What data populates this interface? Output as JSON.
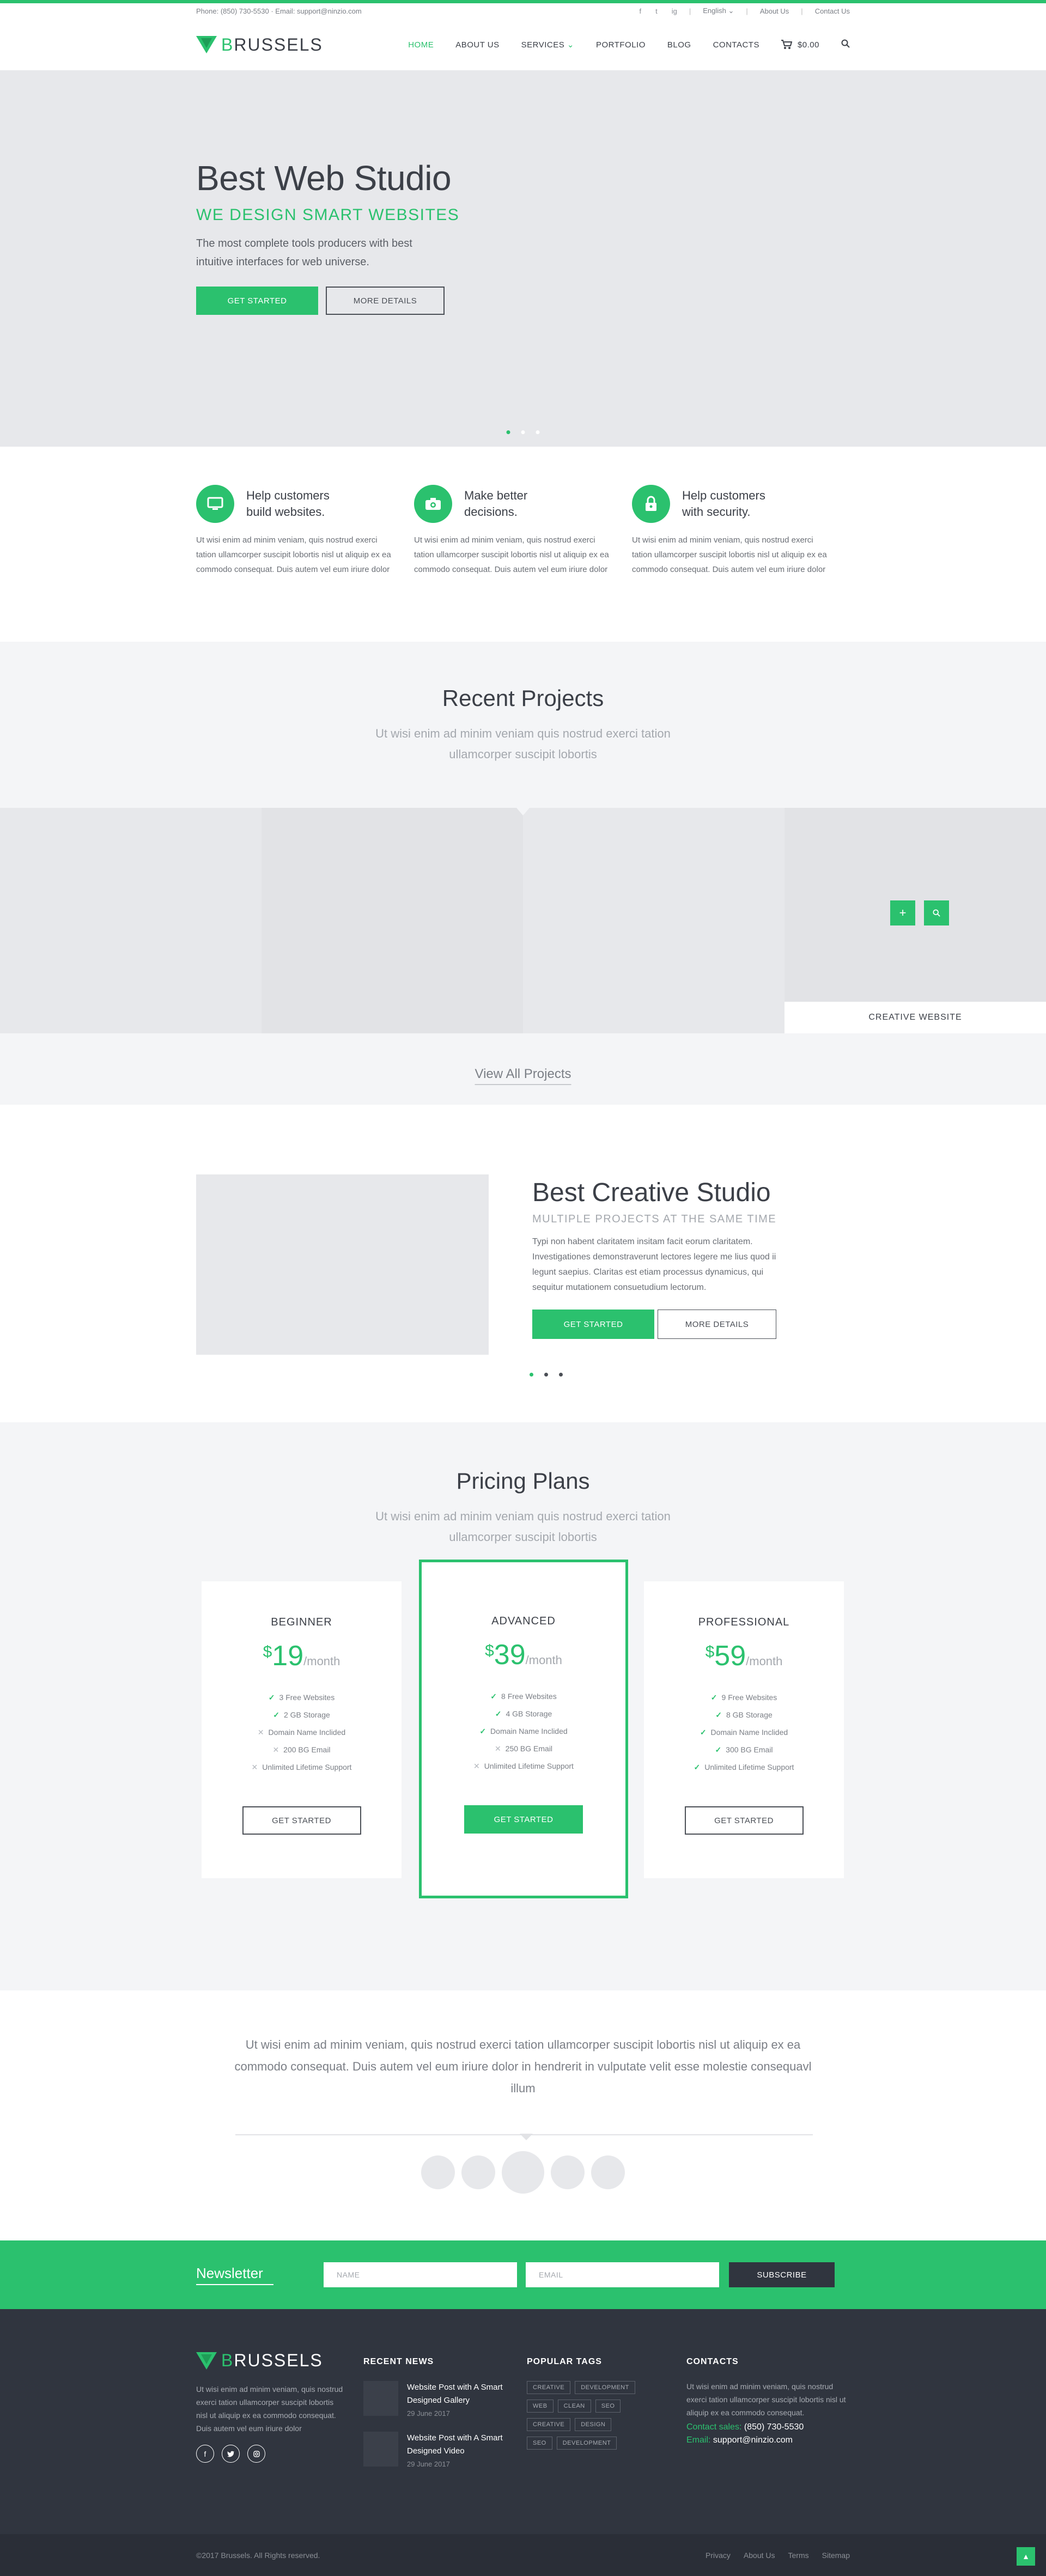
{
  "topbar": {
    "phone": "Phone: (850) 730-5530",
    "email": "Email: support@ninzio.com",
    "social": [
      "f",
      "t",
      "ig"
    ],
    "language": "English",
    "links": [
      "About Us",
      "Contact Us"
    ]
  },
  "header": {
    "logo_b": "B",
    "logo_rest": "RUSSELS",
    "nav": [
      "HOME",
      "ABOUT US",
      "SERVICES",
      "PORTFOLIO",
      "BLOG",
      "CONTACTS"
    ],
    "cart_total": "$0.00"
  },
  "hero": {
    "title": "Best Web Studio",
    "subtitle": "WE DESIGN SMART WEBSITES",
    "text": "The most complete tools producers with best intuitive interfaces for web universe.",
    "primary_btn": "GET STARTED",
    "secondary_btn": "MORE DETAILS"
  },
  "features": [
    {
      "icon": "monitor-icon",
      "title": "Help customers build websites.",
      "text": "Ut wisi enim ad minim veniam, quis nostrud exerci tation ullamcorper suscipit lobortis nisl ut aliquip ex ea commodo consequat. Duis autem vel eum iriure dolor"
    },
    {
      "icon": "camera-icon",
      "title": "Make better decisions.",
      "text": "Ut wisi enim ad minim veniam, quis nostrud exerci tation ullamcorper suscipit lobortis nisl ut aliquip ex ea commodo consequat. Duis autem vel eum iriure dolor"
    },
    {
      "icon": "lock-icon",
      "title": "Help customers with security.",
      "text": "Ut wisi enim ad minim veniam, quis nostrud exerci tation ullamcorper suscipit lobortis nisl ut aliquip ex ea commodo consequat. Duis autem vel eum iriure dolor"
    }
  ],
  "projects": {
    "title": "Recent Projects",
    "subtitle": "Ut wisi enim ad minim veniam quis nostrud exerci tation ullamcorper suscipit lobortis",
    "caption": "CREATIVE WEBSITE",
    "view_all": "View All Projects"
  },
  "studio": {
    "title": "Best Creative Studio",
    "subtitle": "MULTIPLE PROJECTS AT THE SAME TIME",
    "text": "Typi non habent claritatem insitam facit eorum claritatem. Investigationes demonstraverunt lectores legere me lius quod ii legunt saepius. Claritas est etiam processus dynamicus, qui sequitur mutationem consuetudium lectorum.",
    "primary_btn": "GET STARTED",
    "secondary_btn": "MORE DETAILS"
  },
  "pricing": {
    "title": "Pricing Plans",
    "subtitle": "Ut wisi enim ad minim veniam quis nostrud exerci tation ullamcorper suscipit lobortis",
    "plans": [
      {
        "name": "BEGINNER",
        "currency": "$",
        "price": "19",
        "period": "/month",
        "button": "GET STARTED",
        "features": [
          [
            "3 Free Websites",
            true
          ],
          [
            "2 GB Storage",
            true
          ],
          [
            "Domain Name Inclided",
            false
          ],
          [
            "200 BG Email",
            false
          ],
          [
            "Unlimited Lifetime Support",
            false
          ]
        ]
      },
      {
        "name": "ADVANCED",
        "currency": "$",
        "price": "39",
        "period": "/month",
        "button": "GET STARTED",
        "features": [
          [
            "8 Free Websites",
            true
          ],
          [
            "4 GB Storage",
            true
          ],
          [
            "Domain Name Inclided",
            true
          ],
          [
            "250 BG Email",
            false
          ],
          [
            "Unlimited Lifetime Support",
            false
          ]
        ]
      },
      {
        "name": "PROFESSIONAL",
        "currency": "$",
        "price": "59",
        "period": "/month",
        "button": "GET STARTED",
        "features": [
          [
            "9 Free Websites",
            true
          ],
          [
            "8 GB Storage",
            true
          ],
          [
            "Domain Name Inclided",
            true
          ],
          [
            "300 BG Email",
            true
          ],
          [
            "Unlimited Lifetime Support",
            true
          ]
        ]
      }
    ]
  },
  "testimonial": {
    "text": "Ut wisi enim ad minim veniam, quis nostrud exerci tation ullamcorper suscipit lobortis nisl ut aliquip ex ea commodo consequat. Duis autem vel eum iriure dolor in hendrerit in vulputate velit esse molestie consequavl illum"
  },
  "newsletter": {
    "title": "Newsletter",
    "name_placeholder": "NAME",
    "email_placeholder": "EMAIL",
    "button": "SUBSCRIBE"
  },
  "footer": {
    "about_text": "Ut wisi enim ad minim veniam, quis nostrud exerci tation ullamcorper suscipit lobortis nisl ut aliquip ex ea commodo consequat. Duis autem vel eum iriure dolor",
    "recent_news_title": "RECENT NEWS",
    "posts": [
      {
        "title": "Website Post with A Smart Designed Gallery",
        "date": "29 June 2017"
      },
      {
        "title": "Website Post with A Smart Designed Video",
        "date": "29 June 2017"
      }
    ],
    "tags_title": "POPULAR TAGS",
    "tags": [
      [
        "CREATIVE",
        "DEVELOPMENT"
      ],
      [
        "WEB",
        "CLEAN",
        "SEO"
      ],
      [
        "CREATIVE",
        "DESIGN"
      ],
      [
        "SEO",
        "DEVELOPMENT"
      ]
    ],
    "contacts_title": "CONTACTS",
    "contacts_text": "Ut wisi enim ad minim veniam, quis nostrud exerci tation ullamcorper suscipit lobortis nisl ut aliquip ex ea commodo consequat.",
    "contact_sales_label": "Contact sales:",
    "contact_sales_value": "(850) 730-5530",
    "email_label": "Email:",
    "email_value": "support@ninzio.com"
  },
  "bottombar": {
    "copyright": "©2017 Brussels. All Rights reserved.",
    "links": [
      "Privacy",
      "About Us",
      "Terms",
      "Sitemap"
    ]
  },
  "colors": {
    "accent": "#2bc16e",
    "dark": "#30353f",
    "light_bg": "#f4f5f7"
  }
}
